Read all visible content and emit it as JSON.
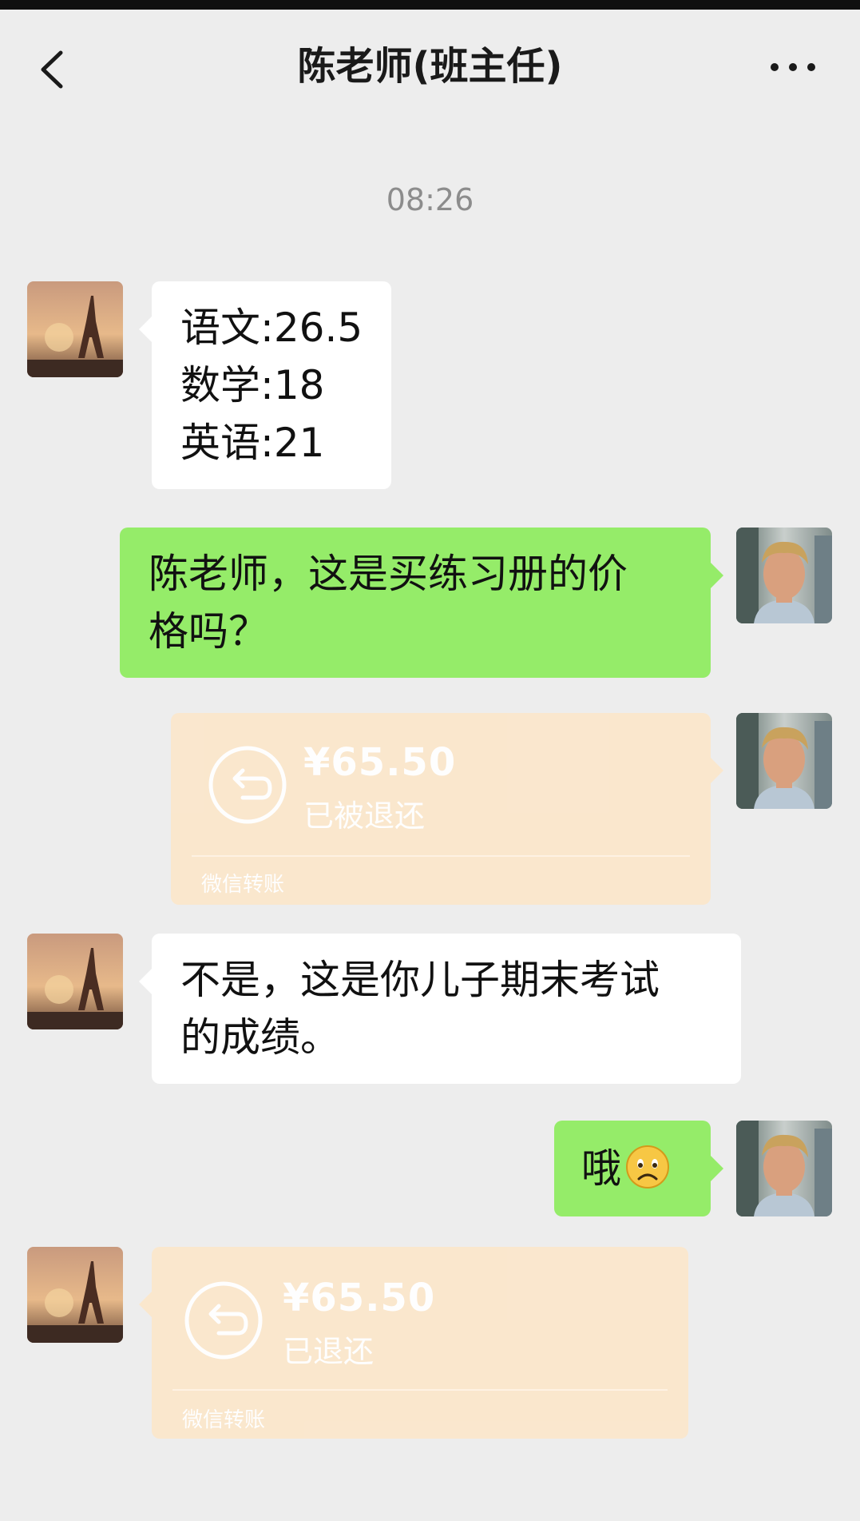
{
  "header": {
    "title": "陈老师(班主任)",
    "back_icon": "chevron-left-icon",
    "more_icon": "ellipsis-icon"
  },
  "timestamp": "08:26",
  "messages": [
    {
      "side": "left",
      "type": "text",
      "lines": [
        "语文:26.5",
        "数学:18",
        "英语:21"
      ]
    },
    {
      "side": "right",
      "type": "text",
      "lines": [
        "陈老师，这是买练习册的价",
        "格吗？"
      ]
    },
    {
      "side": "right",
      "type": "transfer",
      "amount": "¥65.50",
      "status": "已被退还",
      "footer": "微信转账"
    },
    {
      "side": "left",
      "type": "text",
      "lines": [
        "不是，这是你儿子期末考试",
        "的成绩。"
      ]
    },
    {
      "side": "right",
      "type": "text",
      "text": "哦",
      "emoji": "sad-face-icon"
    },
    {
      "side": "left",
      "type": "transfer",
      "amount": "¥65.50",
      "status": "已退还",
      "footer": "微信转账"
    }
  ],
  "colors": {
    "background": "#ededed",
    "bubble_green": "#95ec69",
    "bubble_white": "#ffffff",
    "transfer_card": "#fbe7cc",
    "timestamp": "#8c8c8c"
  }
}
